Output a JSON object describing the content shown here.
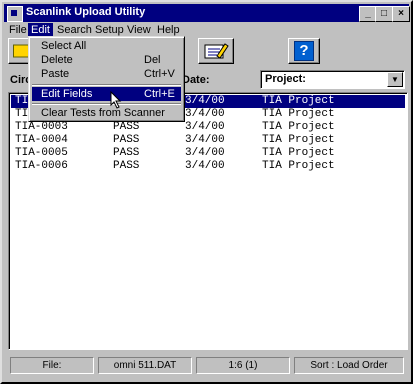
{
  "window": {
    "title": "Scanlink Upload Utility"
  },
  "menubar": {
    "items": [
      "File",
      "Edit",
      "Search",
      "Setup",
      "View",
      "Help"
    ]
  },
  "edit_menu": {
    "items": [
      {
        "label": "Select All",
        "shortcut": ""
      },
      {
        "label": "Delete",
        "shortcut": "Del"
      },
      {
        "label": "Paste",
        "shortcut": "Ctrl+V"
      },
      {
        "label": "Edit Fields",
        "shortcut": "Ctrl+E"
      },
      {
        "label": "Clear Tests from Scanner",
        "shortcut": ""
      }
    ]
  },
  "toolbar": {
    "help_glyph": "?"
  },
  "headers": {
    "circuit": "Circ",
    "date": "Date:"
  },
  "project_select": {
    "value": "Project:"
  },
  "rows": [
    {
      "id": "TI",
      "status": "",
      "date": "3/4/00",
      "project": "TIA Project"
    },
    {
      "id": "TI",
      "status": "",
      "date": "3/4/00",
      "project": "TIA Project"
    },
    {
      "id": "TIA-0003",
      "status": "PASS",
      "date": "3/4/00",
      "project": "TIA Project"
    },
    {
      "id": "TIA-0004",
      "status": "PASS",
      "date": "3/4/00",
      "project": "TIA Project"
    },
    {
      "id": "TIA-0005",
      "status": "PASS",
      "date": "3/4/00",
      "project": "TIA Project"
    },
    {
      "id": "TIA-0006",
      "status": "PASS",
      "date": "3/4/00",
      "project": "TIA Project"
    }
  ],
  "statusbar": {
    "file_label": "File:",
    "file_name": "omni 511.DAT",
    "position": "1:6 (1)",
    "sort": "Sort : Load Order"
  },
  "colors": {
    "titlebar": "#000080",
    "selection": "#000080",
    "face": "#c0c0c0"
  }
}
